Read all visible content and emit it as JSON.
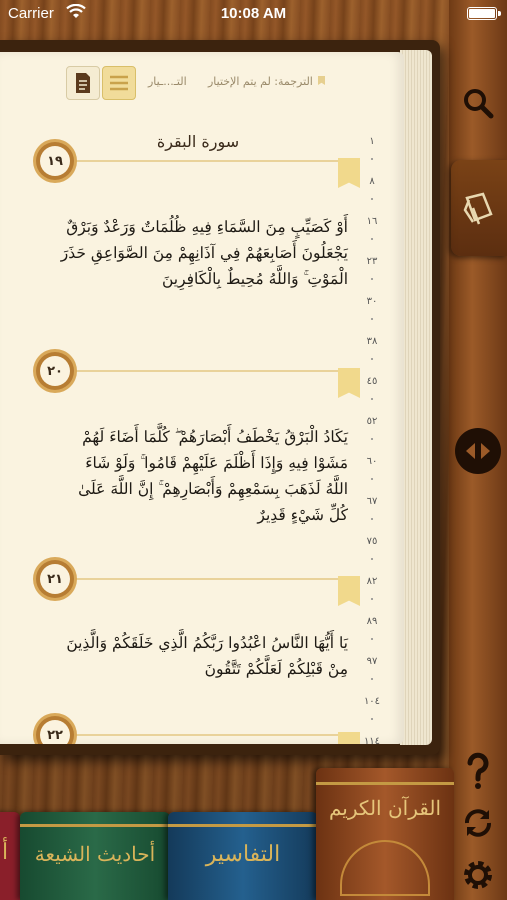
{
  "status_bar": {
    "carrier": "Carrier",
    "time": "10:08 AM"
  },
  "toolbar": {
    "translation": "الترجمة: لم يتم الإختيار",
    "tafsir": "التـ...ـيار"
  },
  "surah_title": "سورة البقرة",
  "verses": [
    {
      "number": "١٩",
      "text": "أَوْ كَصَيِّبٍ مِنَ السَّمَاءِ فِيهِ ظُلُمَاتٌ وَرَعْدٌ وَبَرْقٌ يَجْعَلُونَ أَصَابِعَهُمْ فِي آذَانِهِمْ مِنَ الصَّوَاعِقِ حَذَرَ الْمَوْتِ ۚ وَاللَّهُ مُحِيطٌ بِالْكَافِرِينَ"
    },
    {
      "number": "٢٠",
      "text": "يَكَادُ الْبَرْقُ يَخْطَفُ أَبْصَارَهُمْ ۖ كُلَّمَا أَضَاءَ لَهُمْ مَشَوْا فِيهِ وَإِذَا أَظْلَمَ عَلَيْهِمْ قَامُوا ۚ وَلَوْ شَاءَ اللَّهُ لَذَهَبَ بِسَمْعِهِمْ وَأَبْصَارِهِمْ ۚ إِنَّ اللَّهَ عَلَىٰ كُلِّ شَيْءٍ قَدِيرٌ"
    },
    {
      "number": "٢١",
      "text": "يَا أَيُّهَا النَّاسُ اعْبُدُوا رَبَّكُمُ الَّذِي خَلَقَكُمْ وَالَّذِينَ مِنْ قَبْلِكُمْ لَعَلَّكُمْ تَتَّقُونَ"
    },
    {
      "number": "٢٢",
      "text": ""
    }
  ],
  "page_ruler": [
    "١",
    "٨",
    "١٦",
    "٢٣",
    "٣٠",
    "٣٨",
    "٤٥",
    "٥٢",
    "٦٠",
    "٦٧",
    "٧٥",
    "٨٢",
    "٨٩",
    "٩٧",
    "١٠٤",
    "١١٤"
  ],
  "shelf": {
    "quran": "القرآن الكريم",
    "tafasir": "التفاسير",
    "ahadith": "أحاديث الشيعة",
    "partial": "أ"
  },
  "colors": {
    "page": "#faf3e0",
    "marker": "#b77d33",
    "wood": "#8a4f22",
    "quran_book": "#8b4a1e",
    "tafasir_book": "#1c4a6e",
    "ahadith_book": "#1f5a3c"
  },
  "icons": {
    "search": "search-icon",
    "bookmark_tab": "book-bookmark-icon",
    "nav": "left-right-arrow-icon",
    "help": "question-mark-icon",
    "sync": "sync-icon",
    "settings": "gear-icon"
  }
}
